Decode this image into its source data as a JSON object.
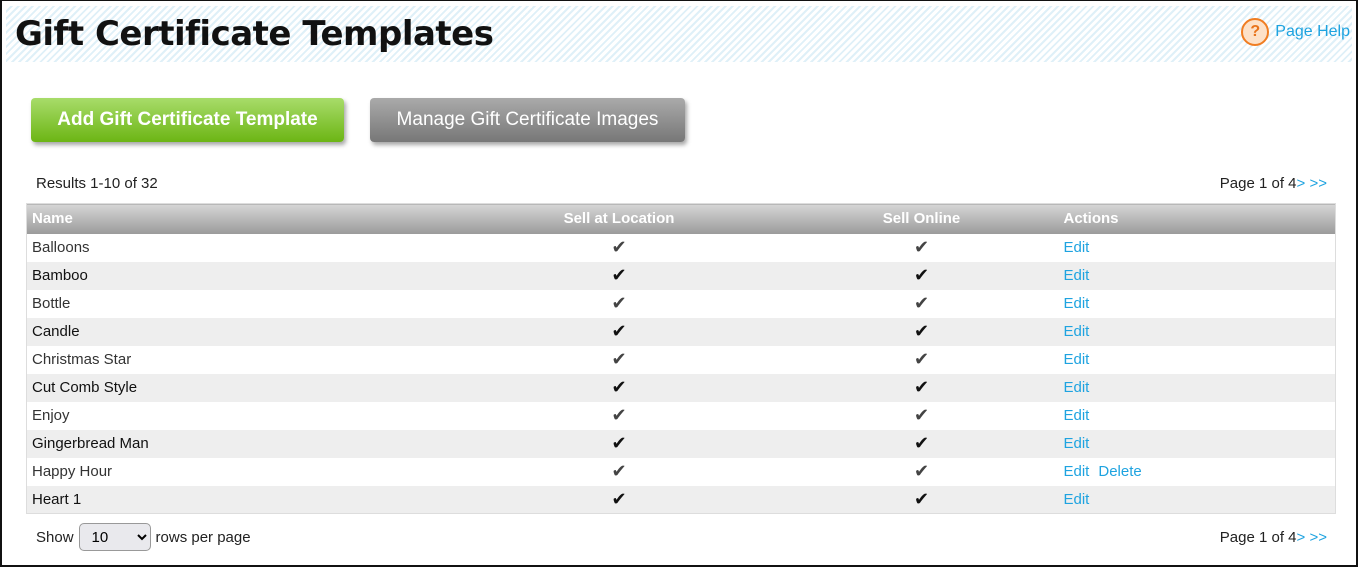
{
  "header": {
    "title": "Gift Certificate Templates",
    "help_label": "Page Help",
    "help_icon": "question-circle-icon"
  },
  "toolbar": {
    "add_label": "Add Gift Certificate Template",
    "manage_label": "Manage Gift Certificate Images"
  },
  "results_text": "Results 1-10 of 32",
  "pager": {
    "text": "Page 1 of 4",
    "next": ">",
    "last": ">>"
  },
  "table": {
    "columns": [
      "Name",
      "Sell at Location",
      "Sell Online",
      "Actions"
    ],
    "rows": [
      {
        "name": "Balloons",
        "location": "✔",
        "online": "✔",
        "edit": "Edit"
      },
      {
        "name": "Bamboo",
        "location": "✔",
        "online": "✔",
        "edit": "Edit"
      },
      {
        "name": "Bottle",
        "location": "✔",
        "online": "✔",
        "edit": "Edit"
      },
      {
        "name": "Candle",
        "location": "✔",
        "online": "✔",
        "edit": "Edit"
      },
      {
        "name": "Christmas Star",
        "location": "✔",
        "online": "✔",
        "edit": "Edit"
      },
      {
        "name": "Cut Comb Style",
        "location": "✔",
        "online": "✔",
        "edit": "Edit"
      },
      {
        "name": "Enjoy",
        "location": "✔",
        "online": "✔",
        "edit": "Edit"
      },
      {
        "name": "Gingerbread Man",
        "location": "✔",
        "online": "✔",
        "edit": "Edit"
      },
      {
        "name": "Happy Hour",
        "location": "✔",
        "online": "✔",
        "edit": "Edit",
        "delete": "Delete"
      },
      {
        "name": "Heart 1",
        "location": "✔",
        "online": "✔",
        "edit": "Edit"
      }
    ]
  },
  "footer": {
    "show_label": "Show",
    "rows_value": "10",
    "rows_suffix": "rows per page"
  },
  "colors": {
    "accent": "#1ea3e0",
    "green": "#6cb514",
    "help": "#f07d22"
  }
}
